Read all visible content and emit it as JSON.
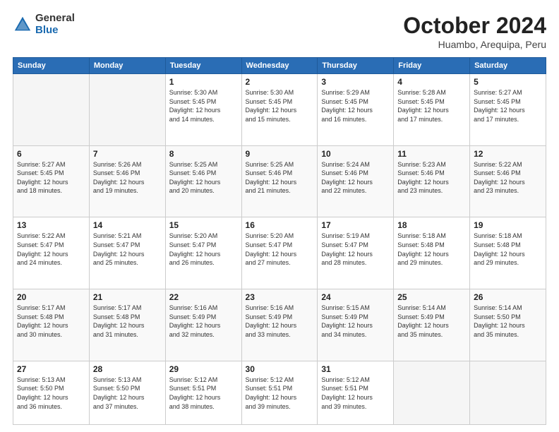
{
  "logo": {
    "general": "General",
    "blue": "Blue"
  },
  "title": "October 2024",
  "location": "Huambo, Arequipa, Peru",
  "headers": [
    "Sunday",
    "Monday",
    "Tuesday",
    "Wednesday",
    "Thursday",
    "Friday",
    "Saturday"
  ],
  "weeks": [
    [
      {
        "day": "",
        "info": ""
      },
      {
        "day": "",
        "info": ""
      },
      {
        "day": "1",
        "info": "Sunrise: 5:30 AM\nSunset: 5:45 PM\nDaylight: 12 hours\nand 14 minutes."
      },
      {
        "day": "2",
        "info": "Sunrise: 5:30 AM\nSunset: 5:45 PM\nDaylight: 12 hours\nand 15 minutes."
      },
      {
        "day": "3",
        "info": "Sunrise: 5:29 AM\nSunset: 5:45 PM\nDaylight: 12 hours\nand 16 minutes."
      },
      {
        "day": "4",
        "info": "Sunrise: 5:28 AM\nSunset: 5:45 PM\nDaylight: 12 hours\nand 17 minutes."
      },
      {
        "day": "5",
        "info": "Sunrise: 5:27 AM\nSunset: 5:45 PM\nDaylight: 12 hours\nand 17 minutes."
      }
    ],
    [
      {
        "day": "6",
        "info": "Sunrise: 5:27 AM\nSunset: 5:45 PM\nDaylight: 12 hours\nand 18 minutes."
      },
      {
        "day": "7",
        "info": "Sunrise: 5:26 AM\nSunset: 5:46 PM\nDaylight: 12 hours\nand 19 minutes."
      },
      {
        "day": "8",
        "info": "Sunrise: 5:25 AM\nSunset: 5:46 PM\nDaylight: 12 hours\nand 20 minutes."
      },
      {
        "day": "9",
        "info": "Sunrise: 5:25 AM\nSunset: 5:46 PM\nDaylight: 12 hours\nand 21 minutes."
      },
      {
        "day": "10",
        "info": "Sunrise: 5:24 AM\nSunset: 5:46 PM\nDaylight: 12 hours\nand 22 minutes."
      },
      {
        "day": "11",
        "info": "Sunrise: 5:23 AM\nSunset: 5:46 PM\nDaylight: 12 hours\nand 23 minutes."
      },
      {
        "day": "12",
        "info": "Sunrise: 5:22 AM\nSunset: 5:46 PM\nDaylight: 12 hours\nand 23 minutes."
      }
    ],
    [
      {
        "day": "13",
        "info": "Sunrise: 5:22 AM\nSunset: 5:47 PM\nDaylight: 12 hours\nand 24 minutes."
      },
      {
        "day": "14",
        "info": "Sunrise: 5:21 AM\nSunset: 5:47 PM\nDaylight: 12 hours\nand 25 minutes."
      },
      {
        "day": "15",
        "info": "Sunrise: 5:20 AM\nSunset: 5:47 PM\nDaylight: 12 hours\nand 26 minutes."
      },
      {
        "day": "16",
        "info": "Sunrise: 5:20 AM\nSunset: 5:47 PM\nDaylight: 12 hours\nand 27 minutes."
      },
      {
        "day": "17",
        "info": "Sunrise: 5:19 AM\nSunset: 5:47 PM\nDaylight: 12 hours\nand 28 minutes."
      },
      {
        "day": "18",
        "info": "Sunrise: 5:18 AM\nSunset: 5:48 PM\nDaylight: 12 hours\nand 29 minutes."
      },
      {
        "day": "19",
        "info": "Sunrise: 5:18 AM\nSunset: 5:48 PM\nDaylight: 12 hours\nand 29 minutes."
      }
    ],
    [
      {
        "day": "20",
        "info": "Sunrise: 5:17 AM\nSunset: 5:48 PM\nDaylight: 12 hours\nand 30 minutes."
      },
      {
        "day": "21",
        "info": "Sunrise: 5:17 AM\nSunset: 5:48 PM\nDaylight: 12 hours\nand 31 minutes."
      },
      {
        "day": "22",
        "info": "Sunrise: 5:16 AM\nSunset: 5:49 PM\nDaylight: 12 hours\nand 32 minutes."
      },
      {
        "day": "23",
        "info": "Sunrise: 5:16 AM\nSunset: 5:49 PM\nDaylight: 12 hours\nand 33 minutes."
      },
      {
        "day": "24",
        "info": "Sunrise: 5:15 AM\nSunset: 5:49 PM\nDaylight: 12 hours\nand 34 minutes."
      },
      {
        "day": "25",
        "info": "Sunrise: 5:14 AM\nSunset: 5:49 PM\nDaylight: 12 hours\nand 35 minutes."
      },
      {
        "day": "26",
        "info": "Sunrise: 5:14 AM\nSunset: 5:50 PM\nDaylight: 12 hours\nand 35 minutes."
      }
    ],
    [
      {
        "day": "27",
        "info": "Sunrise: 5:13 AM\nSunset: 5:50 PM\nDaylight: 12 hours\nand 36 minutes."
      },
      {
        "day": "28",
        "info": "Sunrise: 5:13 AM\nSunset: 5:50 PM\nDaylight: 12 hours\nand 37 minutes."
      },
      {
        "day": "29",
        "info": "Sunrise: 5:12 AM\nSunset: 5:51 PM\nDaylight: 12 hours\nand 38 minutes."
      },
      {
        "day": "30",
        "info": "Sunrise: 5:12 AM\nSunset: 5:51 PM\nDaylight: 12 hours\nand 39 minutes."
      },
      {
        "day": "31",
        "info": "Sunrise: 5:12 AM\nSunset: 5:51 PM\nDaylight: 12 hours\nand 39 minutes."
      },
      {
        "day": "",
        "info": ""
      },
      {
        "day": "",
        "info": ""
      }
    ]
  ]
}
